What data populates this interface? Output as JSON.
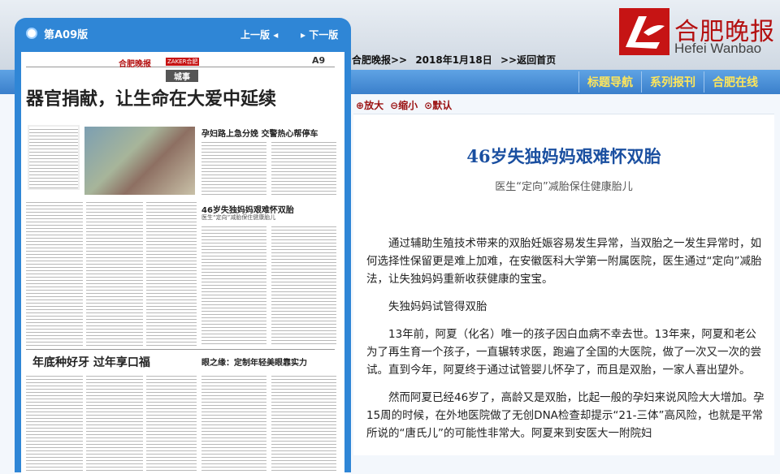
{
  "logo": {
    "cn": "合肥晚报",
    "en": "Hefei Wanbao"
  },
  "breadcrumb": {
    "site": "合肥晚报>>",
    "date": "2018年1月18日",
    "back": ">>返回首页"
  },
  "nav": [
    "标题导航",
    "系列报刊",
    "合肥在线"
  ],
  "panel": {
    "edition": "第A09版",
    "prev": "上一版",
    "next": "下一版"
  },
  "newspaper": {
    "masthead": "合肥晚报",
    "brand": "ZAKER合肥",
    "page_no": "A9",
    "section": "城事",
    "headline": "器官捐献，让生命在大爱中延续",
    "sub1": "孕妇路上急分娩  交警热心帮停车",
    "sub2": "46岁失独妈妈艰难怀双胎",
    "sub2_deck": "医生“定向”减胎保住健康胎儿",
    "sub3": "年底种好牙  过年享口福",
    "sub4": "眼之缘：定制年轻美眼靠实力"
  },
  "toolbar": {
    "zoom_in": "放大",
    "zoom_out": "缩小",
    "default": "默认"
  },
  "article": {
    "headline": "46岁失独妈妈艰难怀双胎",
    "subhead": "医生“定向”减胎保住健康胎儿",
    "paragraphs": [
      "通过辅助生殖技术带来的双胎妊娠容易发生异常，当双胎之一发生异常时，如何选择性保留更是难上加难，在安徽医科大学第一附属医院，医生通过“定向”减胎法，让失独妈妈重新收获健康的宝宝。",
      "失独妈妈试管得双胎",
      "13年前，阿夏（化名）唯一的孩子因白血病不幸去世。13年来，阿夏和老公为了再生育一个孩子，一直辗转求医，跑遍了全国的大医院，做了一次又一次的尝试。直到今年，阿夏终于通过试管婴儿怀孕了，而且是双胎，一家人喜出望外。",
      "然而阿夏已经46岁了，高龄又是双胎，比起一般的孕妇来说风险大大增加。孕15周的时候，在外地医院做了无创DNA检查却提示“21-三体”高风险，也就是平常所说的“唐氏儿”的可能性非常大。阿夏来到安医大一附院妇"
    ]
  }
}
